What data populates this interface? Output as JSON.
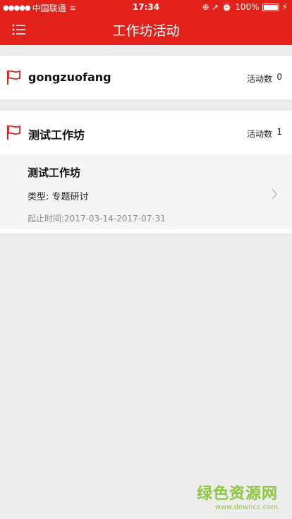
{
  "status_bar": {
    "signal": "●●●●●",
    "carrier": "中国联通",
    "wifi": "≋",
    "time": "17:34",
    "icons": "⊕ ➚ ⏰",
    "battery": "100%",
    "charge": "⚡"
  },
  "navbar": {
    "title": "工作坊活动",
    "menu_icon": "list-menu-icon",
    "accent_color": "#e3211b"
  },
  "groups": [
    {
      "name": "gongzuofang",
      "count_label": "活动数",
      "count": "0",
      "activities": []
    },
    {
      "name": "测试工作坊",
      "count_label": "活动数",
      "count": "1",
      "activities": [
        {
          "title": "测试工作坊",
          "type": "类型: 专题研讨",
          "date_range": "起止时间:2017-03-14-2017-07-31"
        }
      ]
    }
  ],
  "watermark": {
    "main": "绿色资源网",
    "sub": "www.downcc.com"
  }
}
